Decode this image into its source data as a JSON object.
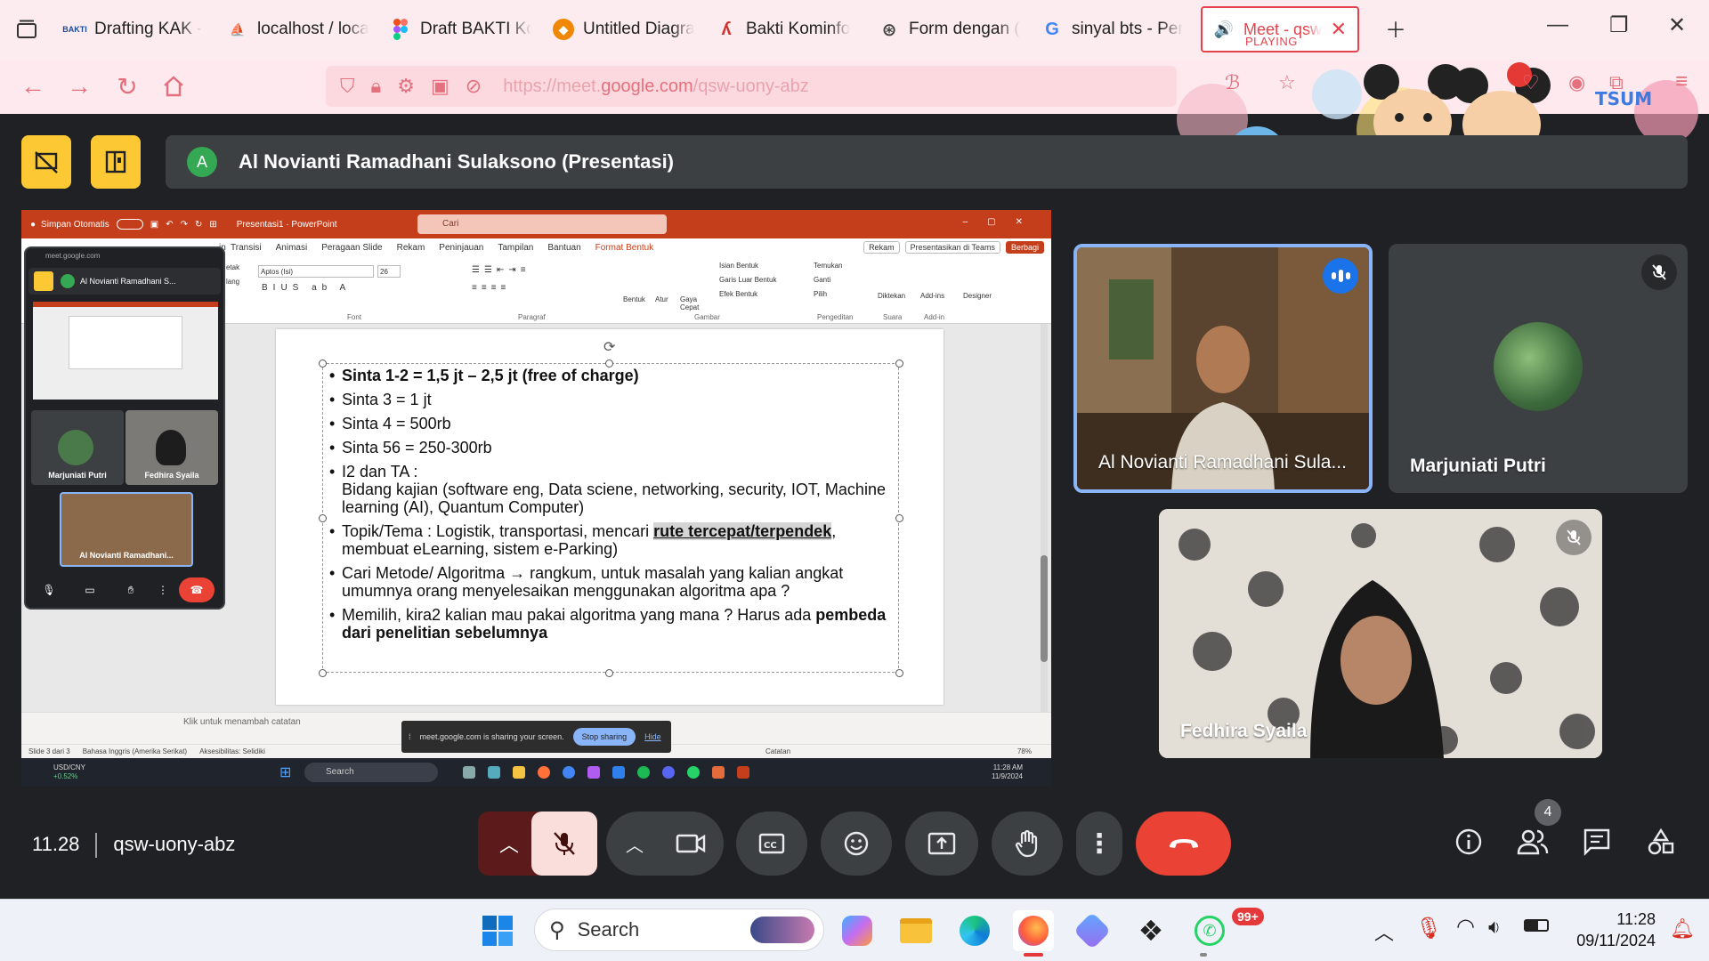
{
  "browser": {
    "tabs": [
      {
        "label": "Drafting KAK -",
        "icon": "bakti-icon"
      },
      {
        "label": "localhost / loca",
        "icon": "phpmyadmin-icon"
      },
      {
        "label": "Draft BAKTI Ko",
        "icon": "figma-icon"
      },
      {
        "label": "Untitled Diagra",
        "icon": "drawio-icon"
      },
      {
        "label": "Bakti Kominfo",
        "icon": "bakti-icon"
      },
      {
        "label": "Form dengan (",
        "icon": "form-icon"
      },
      {
        "label": "sinyal bts - Per",
        "icon": "google-icon"
      }
    ],
    "active_tab": {
      "label": "Meet - qsw",
      "status": "PLAYING"
    },
    "url": {
      "prefix": "https://meet.",
      "domain": "google.com",
      "path": "/qsw-uony-abz"
    }
  },
  "meet": {
    "presenter_initial": "A",
    "presenter_label": "Al Novianti Ramadhani Sulaksono (Presentasi)",
    "participants": [
      {
        "name": "Al Novianti Ramadhani Sula...",
        "speaking": true
      },
      {
        "name": "Marjuniati Putri",
        "muted": true
      },
      {
        "name": "Fedhira Syaila",
        "muted": true
      }
    ],
    "time": "11.28",
    "meeting_code": "qsw-uony-abz",
    "people_count": "4"
  },
  "shared_screen": {
    "ppt": {
      "autosave": "Simpan Otomatis",
      "filename": "Presentasi1  ·  PowerPoint",
      "search": "Cari",
      "tabs": [
        "Transisi",
        "Animasi",
        "Peragaan Slide",
        "Rekam",
        "Peninjauan",
        "Tampilan",
        "Bantuan",
        "Format Bentuk"
      ],
      "tab_left": "in",
      "rekam": "Rekam",
      "teams": "Presentasikan di Teams",
      "share": "Berbagi",
      "font": "Aptos (Isi)",
      "font_size": "26",
      "groups": [
        "Font",
        "Paragraf",
        "Gambar",
        "Pengeditan",
        "Suara",
        "Add-in"
      ],
      "ribbon_labels": [
        "Bentuk",
        "Atur",
        "Gaya Cepat",
        "Isian Bentuk",
        "Garis Luar Bentuk",
        "Efek Bentuk",
        "Temukan",
        "Ganti",
        "Pilih",
        "Diktekan",
        "Add-ins",
        "Designer"
      ],
      "left_labels": [
        "etak",
        "lang"
      ],
      "bullets": [
        {
          "text": "Sinta 1-2 = 1,5 jt – 2,5 jt (free of charge)",
          "bold": true
        },
        {
          "text": "Sinta 3 = 1 jt"
        },
        {
          "text": "Sinta 4 = 500rb"
        },
        {
          "text": "Sinta 56 = 250-300rb"
        },
        {
          "text": "I2 dan TA :",
          "sub": "Bidang kajian (software eng, Data sciene, networking, security, IOT, Machine learning (AI), Quantum Computer)"
        },
        {
          "text_a": "Topik/Tema  : Logistik, transportasi, mencari ",
          "text_b": "rute tercepat/terpendek",
          "text_c": ", membuat eLearning, sistem e-Parking)"
        },
        {
          "text": "Cari Metode/ Algoritma → rangkum, untuk masalah yang kalian angkat umumnya orang menyelesaikan menggunakan algoritma apa ?"
        },
        {
          "text": "Memilih, kira2 kalian mau pakai algoritma yang mana ? Harus ada ",
          "bold_tail": "pembeda dari penelitian sebelumnya"
        }
      ],
      "notes_placeholder": "Klik untuk menambah catatan",
      "status": {
        "slide": "Slide 3 dari 3",
        "lang": "Bahasa Inggris (Amerika Serikat)",
        "access": "Aksesibilitas: Selidiki",
        "notes": "Catatan",
        "zoom": "78%"
      }
    },
    "sharing_bar": {
      "text": "meet.google.com is sharing your screen.",
      "stop": "Stop sharing",
      "hide": "Hide"
    },
    "pip": {
      "url": "meet.google.com",
      "presenter": "Al Novianti Ramadhani S...",
      "tiles": [
        "Marjuniati Putri",
        "Fedhira Syaila",
        "Al Novianti Ramadhani..."
      ]
    },
    "taskbar": {
      "currency": "USD/CNY",
      "change": "+0.52%",
      "search": "Search",
      "time": "11:28 AM",
      "date": "11/9/2024"
    }
  },
  "os_taskbar": {
    "search": "Search",
    "time": "11:28",
    "date": "09/11/2024",
    "whatsapp_badge": "99+"
  },
  "colors": {
    "meet_bg": "#202124",
    "accent_yellow": "#fcc934",
    "end_call": "#ea4335",
    "ppt_red": "#c43e1c",
    "active_tab": "#e5424d"
  }
}
